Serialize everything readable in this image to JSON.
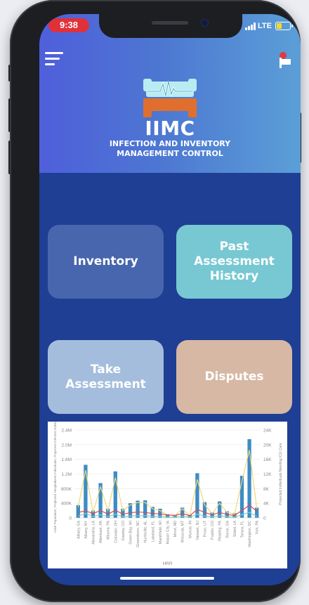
{
  "status_bar": {
    "time": "9:38",
    "network": "LTE",
    "battery_color": "#f4dc1c"
  },
  "header": {
    "menu_icon": "hamburger-menu-icon",
    "flag_icon": "flag-icon",
    "logo_icon": "hospital-bed-heartbeat-logo",
    "title": "IIMC",
    "subtitle": "INFECTION AND INVENTORY MANAGEMENT CONTROL"
  },
  "tiles": [
    {
      "label": "Inventory",
      "color": "#4766ad"
    },
    {
      "label": "Past Assessment History",
      "color": "#77c8d2"
    },
    {
      "label": "Take Assessment",
      "color": "#a4bddc"
    },
    {
      "label": "Disputes",
      "color": "#d7b8a5"
    }
  ],
  "colors": {
    "header_start": "#4f5fdb",
    "header_end": "#5b9fd7",
    "body": "#1f3f94"
  },
  "chart_data": {
    "type": "bar",
    "xlabel": "HRR",
    "ylabel_left": "Adult Population, Projected Hospitalized Individuals, Projected Infected Individuals",
    "ylabel_right": "Projected Individuals Needing ICU Care",
    "y_ticks_left": [
      "0",
      "400K",
      "800K",
      "1.2M",
      "1.6M",
      "2.0M",
      "2.4M"
    ],
    "y_ticks_right": [
      "0",
      "4K",
      "8K",
      "12K",
      "16K",
      "20K",
      "24K"
    ],
    "ylim_left": [
      0,
      2400000
    ],
    "ylim_right": [
      0,
      24000
    ],
    "categories": [
      "Albany, GA",
      "Albany, NY",
      "Alexandria, LA",
      "Allentown, PA",
      "Altoona, PA",
      "Colorado, OH",
      "Greeley, CO",
      "Green Bay, WI",
      "Greensboro, NC",
      "Huntsville, AL",
      "Lakeland, FL",
      "Marshfield, WI",
      "Mason City, IA",
      "Minot, ND",
      "Missoula, MT",
      "Muncie, IN",
      "Newark, NJ",
      "Provo, UT",
      "Pueblo, CO",
      "Reading, PA",
      "Rome, GA",
      "Slidell, LA",
      "Tampa, FL",
      "Washington, DC",
      "York, PA"
    ],
    "series": [
      {
        "name": "Adult Population",
        "kind": "bar",
        "color": "#3d8cc4",
        "values": [
          350000,
          1450000,
          200000,
          950000,
          250000,
          1270000,
          250000,
          400000,
          470000,
          480000,
          300000,
          250000,
          100000,
          80000,
          280000,
          80000,
          1220000,
          430000,
          150000,
          450000,
          180000,
          130000,
          1150000,
          2150000,
          280000
        ]
      },
      {
        "name": "Projected Hospitalized Individuals",
        "kind": "line",
        "color": "#f0d77a",
        "values": [
          300000,
          1300000,
          150000,
          850000,
          200000,
          1100000,
          200000,
          350000,
          420000,
          420000,
          250000,
          200000,
          80000,
          60000,
          250000,
          60000,
          1050000,
          350000,
          120000,
          400000,
          150000,
          100000,
          1000000,
          1850000,
          250000
        ]
      },
      {
        "name": "Projected Infected Individuals",
        "kind": "line",
        "color": "#7fd0c4",
        "values": [
          50000,
          120000,
          40000,
          80000,
          40000,
          100000,
          30000,
          50000,
          60000,
          60000,
          40000,
          40000,
          20000,
          20000,
          40000,
          20000,
          100000,
          50000,
          30000,
          60000,
          30000,
          20000,
          90000,
          150000,
          40000
        ]
      },
      {
        "name": "Projected Individuals Needing ICU Care",
        "kind": "line",
        "axis": "right",
        "color": "#e0474c",
        "values": [
          1500,
          1900,
          1200,
          2000,
          1000,
          2100,
          1000,
          1400,
          1600,
          1500,
          1200,
          1100,
          800,
          700,
          1200,
          600,
          2300,
          1500,
          800,
          1500,
          900,
          700,
          2000,
          3500,
          1800
        ]
      }
    ],
    "grid": true,
    "tick_label_color": "#888888"
  }
}
